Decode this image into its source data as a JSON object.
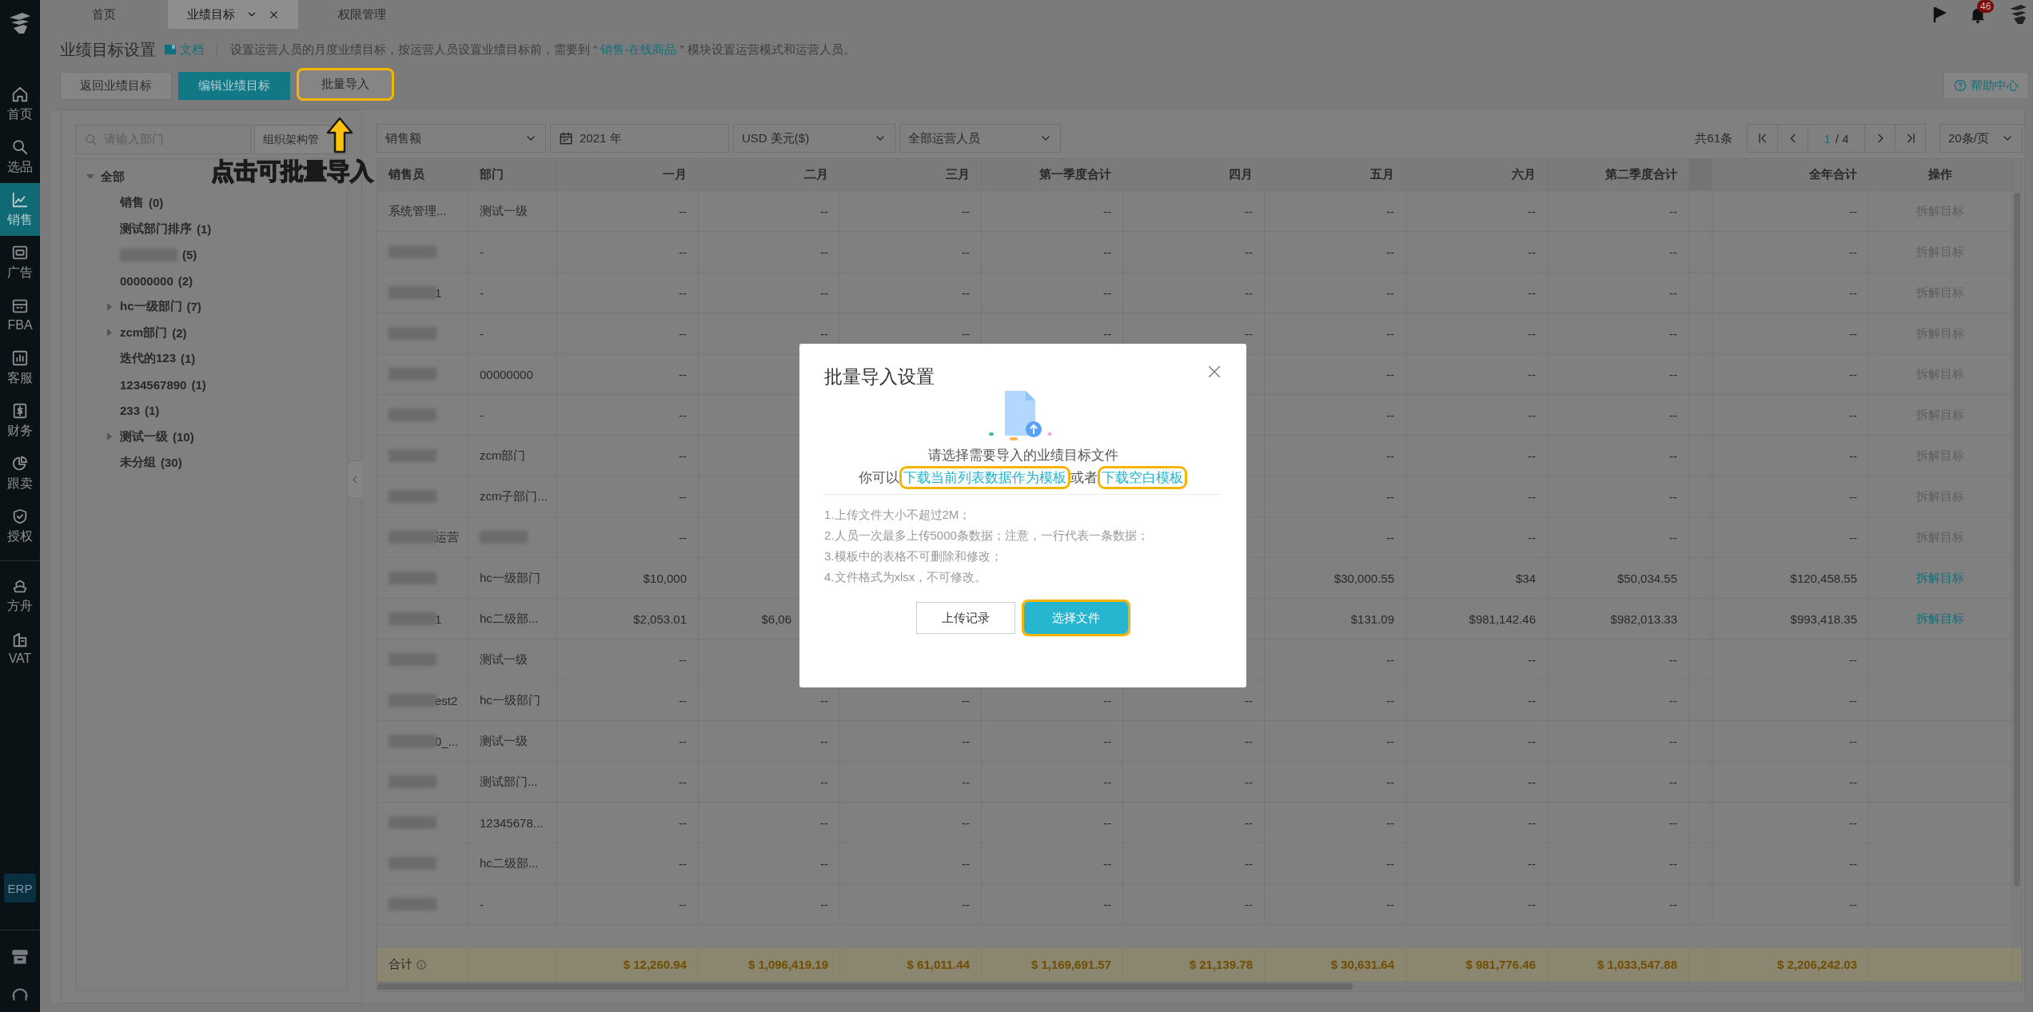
{
  "top_bar": {
    "tabs": [
      {
        "label": "首页",
        "selected": false,
        "closable": false
      },
      {
        "label": "业绩目标",
        "selected": true,
        "closable": true
      },
      {
        "label": "权限管理",
        "selected": false,
        "closable": false
      }
    ],
    "notification_count": "46"
  },
  "nav": {
    "groups": [
      [
        {
          "label": "首页",
          "selected": false
        },
        {
          "label": "选品",
          "selected": false
        },
        {
          "label": "销售",
          "selected": true
        },
        {
          "label": "广告",
          "selected": false
        },
        {
          "label": "FBA",
          "selected": false
        },
        {
          "label": "客服",
          "selected": false
        },
        {
          "label": "财务",
          "selected": false
        },
        {
          "label": "跟卖",
          "selected": false
        },
        {
          "label": "授权",
          "selected": false
        }
      ],
      [
        {
          "label": "方舟",
          "selected": false
        },
        {
          "label": "VAT",
          "selected": false
        }
      ]
    ],
    "erp_badge": "ERP"
  },
  "header": {
    "title": "业绩目标设置",
    "doc_link": "文档",
    "description": {
      "before": "设置运营人员的月度业绩目标，按运营人员设置业绩目标前，需要到 “ ",
      "link": "销售-在线商品",
      "after": " ” 模块设置运营模式和运营人员。"
    },
    "buttons": [
      {
        "label": "返回业绩目标",
        "kind": "default",
        "highlighted": false
      },
      {
        "label": "编辑业绩目标",
        "kind": "primary",
        "highlighted": false
      },
      {
        "label": "批量导入",
        "kind": "default",
        "highlighted": true
      }
    ],
    "help": "帮助中心"
  },
  "tree": {
    "search_placeholder": "请输入部门",
    "manage_button": "组织架构管",
    "root": {
      "label": "全部",
      "expanded": true,
      "children": [
        {
          "label": "销售",
          "count": "(0)"
        },
        {
          "label": "测试部门排序",
          "count": "(1)"
        },
        {
          "blurred": true,
          "count": "(5)"
        },
        {
          "label": "00000000",
          "count": "(2)"
        },
        {
          "label": "hc一级部门",
          "count": "(7)",
          "expanded": false
        },
        {
          "label": "zcm部门",
          "count": "(2)",
          "expanded": false
        },
        {
          "label": "迭代的123",
          "count": "(1)"
        },
        {
          "label": "1234567890",
          "count": "(1)"
        },
        {
          "label": "233",
          "count": "(1)"
        },
        {
          "label": "测试一级",
          "count": "(10)",
          "expanded": false
        },
        {
          "label": "未分组",
          "count": "(30)"
        }
      ]
    }
  },
  "filters": {
    "metric": "销售额",
    "year": "2021 年",
    "currency": "USD 美元($)",
    "staff": "全部运营人员"
  },
  "pager": {
    "total": "共61条",
    "current": "1",
    "pages": "/ 4",
    "page_size": "20条/页"
  },
  "table": {
    "columns": [
      "销售员",
      "部门",
      "一月",
      "二月",
      "三月",
      "第一季度合计",
      "四月",
      "五月",
      "六月",
      "第二季度合计",
      "全年合计",
      "操作"
    ],
    "rows": [
      {
        "name": "系统管理...",
        "name_blurred": false,
        "dept": "测试一级",
        "values": {
          "jan": "--",
          "feb": "--",
          "mar": "--",
          "q1": "--",
          "apr": "--",
          "may": "--",
          "jun": "--",
          "q2": "--",
          "year": "--"
        },
        "action": {
          "label": "拆解目标",
          "enabled": false
        }
      },
      {
        "name_blurred": true,
        "dept": "-",
        "values": {
          "jan": "--",
          "feb": "--",
          "mar": "--",
          "q1": "--",
          "apr": "--",
          "may": "--",
          "jun": "--",
          "q2": "--",
          "year": "--"
        },
        "action": {
          "label": "拆解目标",
          "enabled": false
        }
      },
      {
        "name": "1",
        "name_blurred": true,
        "dept": "-",
        "values": {
          "jan": "--",
          "feb": "--",
          "mar": "--",
          "q1": "--",
          "apr": "--",
          "may": "--",
          "jun": "--",
          "q2": "--",
          "year": "--"
        },
        "action": {
          "label": "拆解目标",
          "enabled": false
        }
      },
      {
        "name_blurred": true,
        "dept": "-",
        "values": {
          "jan": "--",
          "feb": "--",
          "mar": "--",
          "q1": "--",
          "apr": "--",
          "may": "--",
          "jun": "--",
          "q2": "--",
          "year": "--"
        },
        "action": {
          "label": "拆解目标",
          "enabled": false
        }
      },
      {
        "name_blurred": true,
        "dept": "00000000",
        "values": {
          "jan": "--",
          "may": "--",
          "jun": "--",
          "q2": "--",
          "year": "--"
        },
        "action": {
          "label": "拆解目标",
          "enabled": false
        }
      },
      {
        "name_blurred": true,
        "dept": "-",
        "values": {
          "jan": "--",
          "may": "--",
          "jun": "--",
          "q2": "--",
          "year": "--"
        },
        "action": {
          "label": "拆解目标",
          "enabled": false
        }
      },
      {
        "name_blurred": true,
        "dept": "zcm部门",
        "values": {
          "jan": "--",
          "may": "--",
          "jun": "--",
          "q2": "--",
          "year": "--"
        },
        "action": {
          "label": "拆解目标",
          "enabled": false
        }
      },
      {
        "name_blurred": true,
        "dept": "zcm子部门...",
        "values": {
          "jan": "--",
          "may": "--",
          "jun": "--",
          "q2": "--",
          "year": "--"
        },
        "action": {
          "label": "拆解目标",
          "enabled": false
        }
      },
      {
        "name": "运营",
        "name_blurred": true,
        "dept_blurred": true,
        "values": {
          "jan": "--",
          "may": "--",
          "jun": "--",
          "q2": "--",
          "year": "--"
        },
        "action": {
          "label": "拆解目标",
          "enabled": false
        }
      },
      {
        "name_blurred": true,
        "dept": "hc一级部门",
        "values": {
          "jan": "$10,000",
          "may": "$30,000.55",
          "jun": "$34",
          "q2": "$50,034.55",
          "year": "$120,458.55"
        },
        "action": {
          "label": "拆解目标",
          "enabled": true
        }
      },
      {
        "name": "1",
        "name_blurred": true,
        "dept": "hc二级部...",
        "values": {
          "jan": "$2,053.01",
          "feb": {
            "text": "$6,06",
            "cut": true
          },
          "may": "$131.09",
          "jun": "$981,142.46",
          "q2": "$982,013.33",
          "year": "$993,418.35"
        },
        "action": {
          "label": "拆解目标",
          "enabled": true
        }
      },
      {
        "name_blurred": true,
        "dept": "测试一级",
        "values": {
          "jan": "--",
          "may": "--",
          "jun": "--",
          "q2": "--",
          "year": "--"
        }
      },
      {
        "name": "est2",
        "name_blurred": true,
        "dept": "hc一级部门",
        "values": {
          "jan": "--",
          "feb": "--",
          "mar": "--",
          "q1": "--",
          "apr": "--",
          "may": "--",
          "jun": "--",
          "q2": "--",
          "year": "--"
        }
      },
      {
        "name": "0_...",
        "name_blurred": true,
        "dept": "测试一级",
        "values": {
          "jan": "--",
          "feb": "--",
          "mar": "--",
          "q1": "--",
          "apr": "--",
          "may": "--",
          "jun": "--",
          "q2": "--",
          "year": "--"
        }
      },
      {
        "name_blurred": true,
        "dept": "测试部门...",
        "values": {
          "jan": "--",
          "feb": "--",
          "mar": "--",
          "q1": "--",
          "apr": "--",
          "may": "--",
          "jun": "--",
          "q2": "--",
          "year": "--"
        }
      },
      {
        "name_blurred": true,
        "dept": "12345678...",
        "values": {
          "jan": "--",
          "feb": "--",
          "mar": "--",
          "q1": "--",
          "apr": "--",
          "may": "--",
          "jun": "--",
          "q2": "--",
          "year": "--"
        }
      },
      {
        "name_blurred": true,
        "dept": "hc二级部...",
        "values": {
          "jan": "--",
          "feb": "--",
          "mar": "--",
          "q1": "--",
          "apr": "--",
          "may": "--",
          "jun": "--",
          "q2": "--",
          "year": "--"
        }
      },
      {
        "name_blurred": true,
        "dept": "-",
        "values": {
          "jan": "--",
          "feb": "--",
          "mar": "--",
          "q1": "--",
          "apr": "--",
          "may": "--",
          "jun": "--",
          "q2": "--",
          "year": "--"
        }
      }
    ],
    "totals": {
      "label": "合计",
      "values": [
        "$ 12,260.94",
        "$ 1,096,419.19",
        "$ 61,011.44",
        "$ 1,169,691.57",
        "$ 21,139.78",
        "$ 30,631.64",
        "$ 981,776.46",
        "$ 1,033,547.88",
        "$ 2,206,242.03"
      ]
    }
  },
  "dialog": {
    "title": "批量导入设置",
    "prompt": "请选择需要导入的业绩目标文件",
    "template_line": {
      "prefix": "你可以",
      "middle": "或者",
      "links": [
        {
          "label": "下载当前列表数据作为模板",
          "highlighted": true
        },
        {
          "label": "下载空白模板",
          "highlighted": true
        }
      ]
    },
    "notes": [
      "1.上传文件大小不超过2M；",
      "2.人员一次最多上传5000条数据；注意，一行代表一条数据；",
      "3.模板中的表格不可删除和修改；",
      "4.文件格式为xlsx，不可修改。"
    ],
    "buttons": [
      {
        "label": "上传记录",
        "kind": "default",
        "highlighted": false
      },
      {
        "label": "选择文件",
        "kind": "primary",
        "highlighted": true
      }
    ]
  },
  "callout": {
    "text": "点击可批量导入"
  }
}
